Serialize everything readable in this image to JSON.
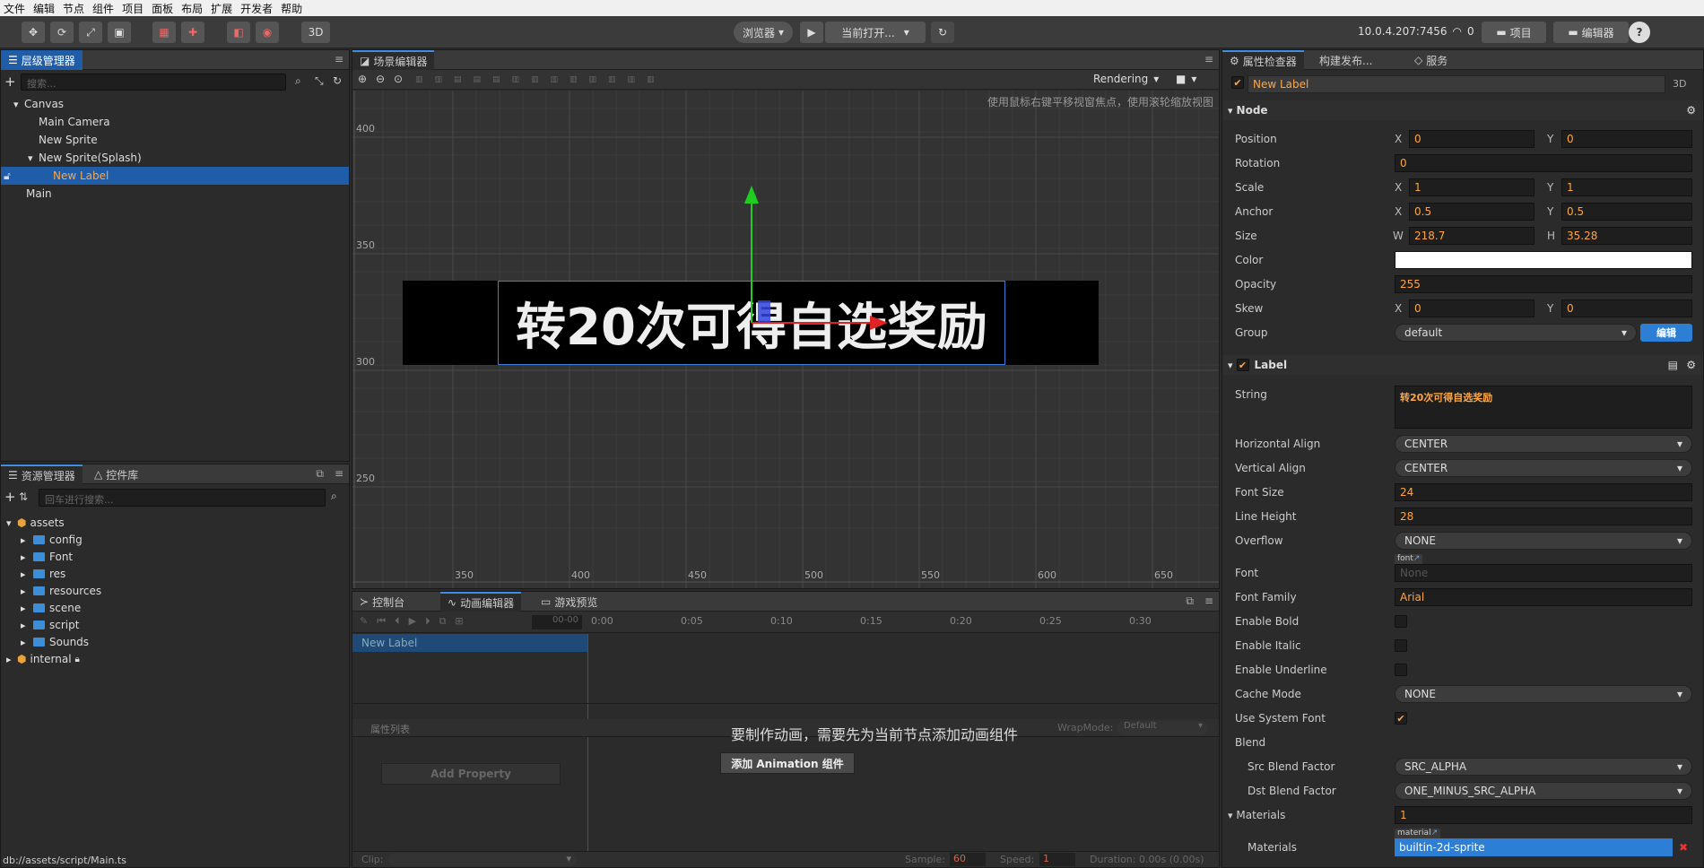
{
  "menu": [
    "文件",
    "编辑",
    "节点",
    "组件",
    "项目",
    "面板",
    "布局",
    "扩展",
    "开发者",
    "帮助"
  ],
  "toolbar": {
    "btn_3d": "3D",
    "browser_label": "浏览器",
    "current_open": "当前打开...",
    "ip": "10.0.4.207:7456",
    "wifi_count": "0",
    "project_btn": "项目",
    "editor_btn": "编辑器",
    "help": "?"
  },
  "hierarchy": {
    "tab": "层级管理器",
    "search_placeholder": "搜索...",
    "nodes": [
      {
        "label": "Canvas",
        "arrow": "▾"
      },
      {
        "label": "Main Camera",
        "arrow": ""
      },
      {
        "label": "New Sprite",
        "arrow": ""
      },
      {
        "label": "New Sprite(Splash)",
        "arrow": "▾"
      },
      {
        "label": "New Label",
        "arrow": ""
      },
      {
        "label": "Main",
        "arrow": ""
      }
    ]
  },
  "assets": {
    "tab1": "资源管理器",
    "tab2": "控件库",
    "search_placeholder": "回车进行搜索...",
    "root": "assets",
    "folders": [
      "config",
      "Font",
      "res",
      "resources",
      "scene",
      "script",
      "Sounds"
    ],
    "internal": "internal",
    "status": "db://assets/script/Main.ts"
  },
  "scene": {
    "tab": "场景编辑器",
    "rendering": "Rendering",
    "hint": "使用鼠标右键平移视窗焦点，使用滚轮缩放视图",
    "y_ticks": [
      "400",
      "350",
      "300",
      "250"
    ],
    "x_ticks": [
      "350",
      "400",
      "450",
      "500",
      "550",
      "600",
      "650"
    ],
    "label_text": "转20次可得自选奖励"
  },
  "bottom": {
    "tab_console": "控制台",
    "tab_anim": "动画编辑器",
    "tab_preview": "游戏预览",
    "timecode": "00-00",
    "time_ticks": [
      "0:00",
      "0:05",
      "0:10",
      "0:15",
      "0:20",
      "0:25",
      "0:30"
    ],
    "node_name": "New Label",
    "message": "要制作动画，需要先为当前节点添加动画组件",
    "prop_list": "属性列表",
    "wrapmode_label": "WrapMode:",
    "wrapmode_value": "Default",
    "add_anim_btn": "添加 Animation 组件",
    "add_property": "Add Property",
    "clip_label": "Clip:",
    "sample_label": "Sample:",
    "sample_value": "60",
    "speed_label": "Speed:",
    "speed_value": "1",
    "duration": "Duration: 0.00s (0.00s)"
  },
  "inspector": {
    "tab1": "属性检查器",
    "tab2": "构建发布...",
    "tab3": "服务",
    "node_name": "New Label",
    "btn_3d": "3D",
    "node_section": "Node",
    "position": {
      "label": "Position",
      "x": "0",
      "y": "0"
    },
    "rotation": {
      "label": "Rotation",
      "value": "0"
    },
    "scale": {
      "label": "Scale",
      "x": "1",
      "y": "1"
    },
    "anchor": {
      "label": "Anchor",
      "x": "0.5",
      "y": "0.5"
    },
    "size": {
      "label": "Size",
      "w": "218.7",
      "h": "35.28"
    },
    "color_label": "Color",
    "opacity": {
      "label": "Opacity",
      "value": "255"
    },
    "skew": {
      "label": "Skew",
      "x": "0",
      "y": "0"
    },
    "group": {
      "label": "Group",
      "value": "default",
      "edit_btn": "编辑"
    },
    "axis": {
      "x": "X",
      "y": "Y",
      "w": "W",
      "h": "H"
    },
    "label_section": "Label",
    "string": {
      "label": "String",
      "value": "转20次可得自选奖励"
    },
    "h_align": {
      "label": "Horizontal Align",
      "value": "CENTER"
    },
    "v_align": {
      "label": "Vertical Align",
      "value": "CENTER"
    },
    "font_size": {
      "label": "Font Size",
      "value": "24"
    },
    "line_height": {
      "label": "Line Height",
      "value": "28"
    },
    "overflow": {
      "label": "Overflow",
      "value": "NONE"
    },
    "font": {
      "label": "Font",
      "tag": "font",
      "value": "None"
    },
    "font_family": {
      "label": "Font Family",
      "value": "Arial"
    },
    "enable_bold": "Enable Bold",
    "enable_italic": "Enable Italic",
    "enable_underline": "Enable Underline",
    "cache_mode": {
      "label": "Cache Mode",
      "value": "NONE"
    },
    "use_system_font": "Use System Font",
    "blend": "Blend",
    "src_blend": {
      "label": "Src Blend Factor",
      "value": "SRC_ALPHA"
    },
    "dst_blend": {
      "label": "Dst Blend Factor",
      "value": "ONE_MINUS_SRC_ALPHA"
    },
    "materials_section": {
      "label": "Materials",
      "value": "1"
    },
    "materials": {
      "label": "Materials",
      "tag": "material",
      "value": "builtin-2d-sprite"
    }
  },
  "colors": {
    "accent": "#1f5da8",
    "orange": "#ffa544"
  }
}
